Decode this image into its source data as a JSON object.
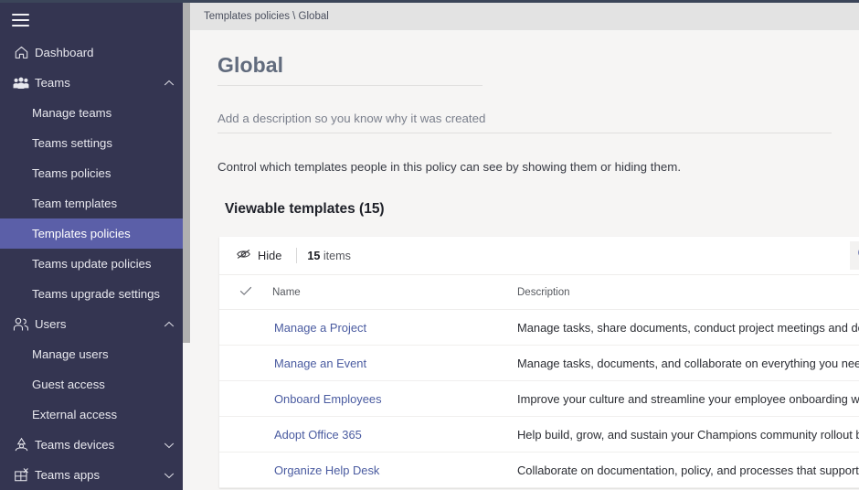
{
  "sidebar": {
    "menu_icon": "hamburger-icon",
    "items": [
      {
        "label": "Dashboard",
        "icon": "home-icon",
        "level": "top",
        "expand": ""
      },
      {
        "label": "Teams",
        "icon": "people-icon",
        "level": "top",
        "expand": "chevron-up-icon"
      },
      {
        "label": "Manage teams",
        "icon": "",
        "level": "child",
        "expand": ""
      },
      {
        "label": "Teams settings",
        "icon": "",
        "level": "child",
        "expand": ""
      },
      {
        "label": "Teams policies",
        "icon": "",
        "level": "child",
        "expand": ""
      },
      {
        "label": "Team templates",
        "icon": "",
        "level": "child",
        "expand": ""
      },
      {
        "label": "Templates policies",
        "icon": "",
        "level": "child",
        "expand": "",
        "selected": true
      },
      {
        "label": "Teams update policies",
        "icon": "",
        "level": "child",
        "expand": ""
      },
      {
        "label": "Teams upgrade settings",
        "icon": "",
        "level": "child",
        "expand": ""
      },
      {
        "label": "Users",
        "icon": "users-icon",
        "level": "top",
        "expand": "chevron-up-icon"
      },
      {
        "label": "Manage users",
        "icon": "",
        "level": "child",
        "expand": ""
      },
      {
        "label": "Guest access",
        "icon": "",
        "level": "child",
        "expand": ""
      },
      {
        "label": "External access",
        "icon": "",
        "level": "child",
        "expand": ""
      },
      {
        "label": "Teams devices",
        "icon": "device-icon",
        "level": "top",
        "expand": "chevron-down-icon"
      },
      {
        "label": "Teams apps",
        "icon": "apps-icon",
        "level": "top",
        "expand": "chevron-down-icon"
      }
    ]
  },
  "breadcrumb": {
    "text": "Templates policies \\ Global"
  },
  "policy": {
    "name": "Global",
    "description_placeholder": "Add a description so you know why it was created",
    "description_value": "",
    "helper_text": "Control which templates people in this policy can see by showing them or hiding them.",
    "section_title": "Viewable templates (15)"
  },
  "toolbar": {
    "hide_label": "Hide",
    "hide_icon": "eye-hide-icon",
    "item_count": "15",
    "item_count_suffix": "items",
    "search_icon": "search-icon"
  },
  "table": {
    "columns": {
      "select_icon": "checkmark-icon",
      "name": "Name",
      "description": "Description"
    },
    "rows": [
      {
        "name": "Manage a Project",
        "description": "Manage tasks, share documents, conduct project meetings and docum..."
      },
      {
        "name": "Manage an Event",
        "description": "Manage tasks, documents, and collaborate on everything you need to ..."
      },
      {
        "name": "Onboard Employees",
        "description": "Improve your culture and streamline your employee onboarding with t..."
      },
      {
        "name": "Adopt Office 365",
        "description": "Help build, grow, and sustain your Champions community rollout by ev..."
      },
      {
        "name": "Organize Help Desk",
        "description": "Collaborate on documentation, policy, and processes that support your..."
      }
    ]
  },
  "colors": {
    "sidebar_bg": "#343551",
    "sidebar_selected": "#5b5fa8",
    "accent_link": "#4a5ba0",
    "top_strip": "#3b4559",
    "page_bg": "#f6f5f4"
  }
}
